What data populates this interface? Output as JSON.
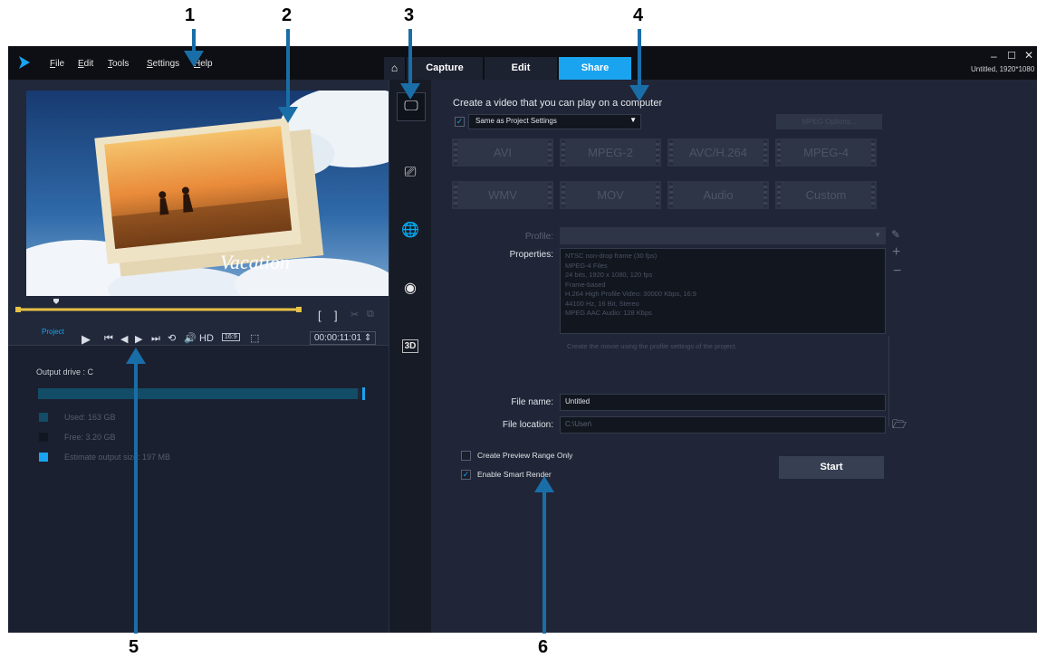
{
  "callouts": [
    "1",
    "2",
    "3",
    "4",
    "5",
    "6"
  ],
  "menu": {
    "file": "File",
    "edit": "Edit",
    "tools": "Tools",
    "settings": "Settings",
    "help": "Help"
  },
  "tabs": {
    "capture": "Capture",
    "edit": "Edit",
    "share": "Share"
  },
  "window": {
    "info": "Untitled, 1920*1080"
  },
  "preview": {
    "caption": "Vacation"
  },
  "playback": {
    "project_label": "Project",
    "hd": "HD",
    "ratio": "16:9",
    "timecode": "00:00:11:01"
  },
  "output": {
    "drive": "Output drive : C",
    "usage_fraction": 0.985,
    "used": "Used: 163 GB",
    "free": "Free: 3.20 GB",
    "estimate": "Estimate output size: 197 MB"
  },
  "share": {
    "title": "Create a video that you can play on a computer",
    "settings_value": "Same as Project Settings",
    "mpeg_options": "MPEG Options...",
    "formats": [
      "AVI",
      "MPEG-2",
      "AVC/H.264",
      "MPEG-4",
      "WMV",
      "MOV",
      "Audio",
      "Custom"
    ],
    "profile_label": "Profile:",
    "properties_label": "Properties:",
    "properties": [
      "NTSC non-drop frame (30 fps)",
      "MPEG-4 Files",
      "24 bits, 1920 x 1080, 120 fps",
      "Frame-based",
      "H.264 High Profile Video: 30000 Kbps, 16:9",
      "44100 Hz, 16 Bit, Stereo",
      "MPEG AAC Audio: 128 Kbps"
    ],
    "hint": "Create the movie using the profile settings of the project.",
    "file_name_label": "File name:",
    "file_name_value": "Untitled",
    "file_location_label": "File location:",
    "file_location_value": "C:\\User\\",
    "preview_range_label": "Create Preview Range Only",
    "smart_render_label": "Enable Smart Render",
    "start_label": "Start"
  },
  "colors": {
    "accent": "#1aa3ee",
    "arrow": "#1a6ea8",
    "background": "#1f2431"
  }
}
